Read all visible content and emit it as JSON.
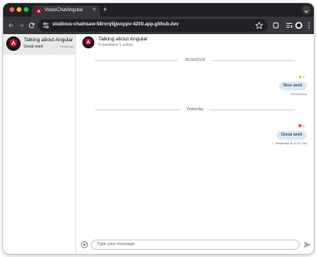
{
  "browser": {
    "tab_title": "VideoChatAngular",
    "tab_close": "×",
    "new_tab": "+",
    "url": "studious-chainsaw-58rxrq5jjwcppv-4200.app.github.dev"
  },
  "sidebar": {
    "channels": [
      {
        "name": "Talking about Angular",
        "preview": "Great work",
        "time": "✓ Yesterday"
      }
    ]
  },
  "header": {
    "title": "Talking about Angular",
    "subtitle": "0 members 1 online"
  },
  "messages": {
    "dividers": [
      "05/30/2024",
      "Yesterday"
    ],
    "items": [
      {
        "text": "Nice work",
        "reaction": "👍 1",
        "meta": "05/30/2024"
      },
      {
        "text": "Great work",
        "reaction": "❤️ 1",
        "meta": "✓ Yesterday at 11:07 AM"
      }
    ]
  },
  "composer": {
    "placeholder": "Type your message"
  },
  "icons": {
    "channel_avatar": "angular-logo-icon",
    "add": "plus-circle-icon",
    "send": "send-icon"
  },
  "colors": {
    "bubble": "#dbe8f7",
    "selected_channel": "#e9e9e9",
    "angular_red": "#dd0031"
  }
}
